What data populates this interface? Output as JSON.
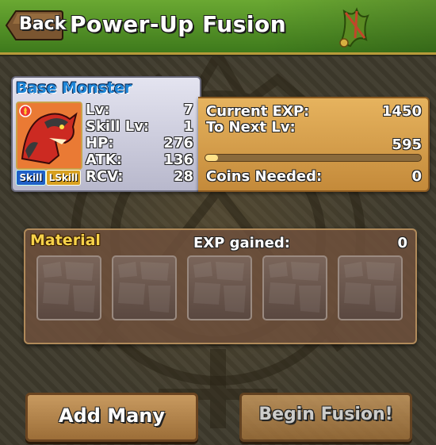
{
  "header": {
    "back_label": "Back",
    "title": "Power-Up Fusion"
  },
  "base_monster": {
    "title": "Base Monster",
    "attribute": "fire",
    "badges": {
      "skill": "Skill",
      "lskill": "LSkill"
    },
    "stats": [
      {
        "label": "Lv:",
        "value": "7"
      },
      {
        "label": "Skill Lv:",
        "value": "1"
      },
      {
        "label": "HP:",
        "value": "276"
      },
      {
        "label": "ATK:",
        "value": "136"
      },
      {
        "label": "RCV:",
        "value": "28"
      }
    ]
  },
  "exp": {
    "current_label": "Current EXP:",
    "current_value": "1450",
    "next_label": "To Next Lv:",
    "next_value": "595",
    "progress_fraction": 0.06,
    "coins_label": "Coins Needed:",
    "coins_value": "0"
  },
  "material": {
    "title": "Material",
    "exp_gained_label": "EXP gained:",
    "exp_gained_value": "0",
    "slot_count": 5
  },
  "buttons": {
    "add_many": "Add Many",
    "begin_fusion": "Begin Fusion!"
  },
  "colors": {
    "header_green": "#4e8f24",
    "base_title_blue": "#1e86d8",
    "material_title_yellow": "#f6d24a"
  }
}
